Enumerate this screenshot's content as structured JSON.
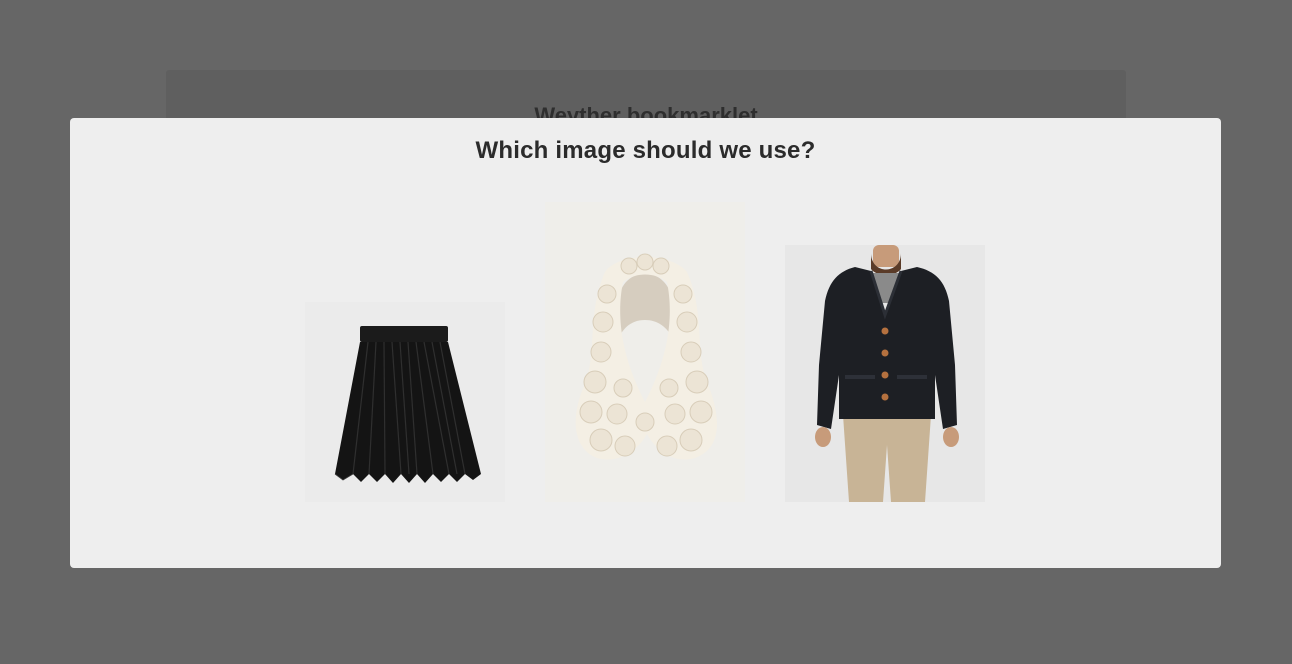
{
  "background": {
    "title": "Weyther bookmarklet"
  },
  "modal": {
    "title": "Which image should we use?",
    "images": [
      {
        "name": "skirt",
        "icon": "pleated-skirt-image"
      },
      {
        "name": "collar",
        "icon": "knit-collar-image"
      },
      {
        "name": "cardigan",
        "icon": "man-cardigan-image"
      }
    ]
  }
}
